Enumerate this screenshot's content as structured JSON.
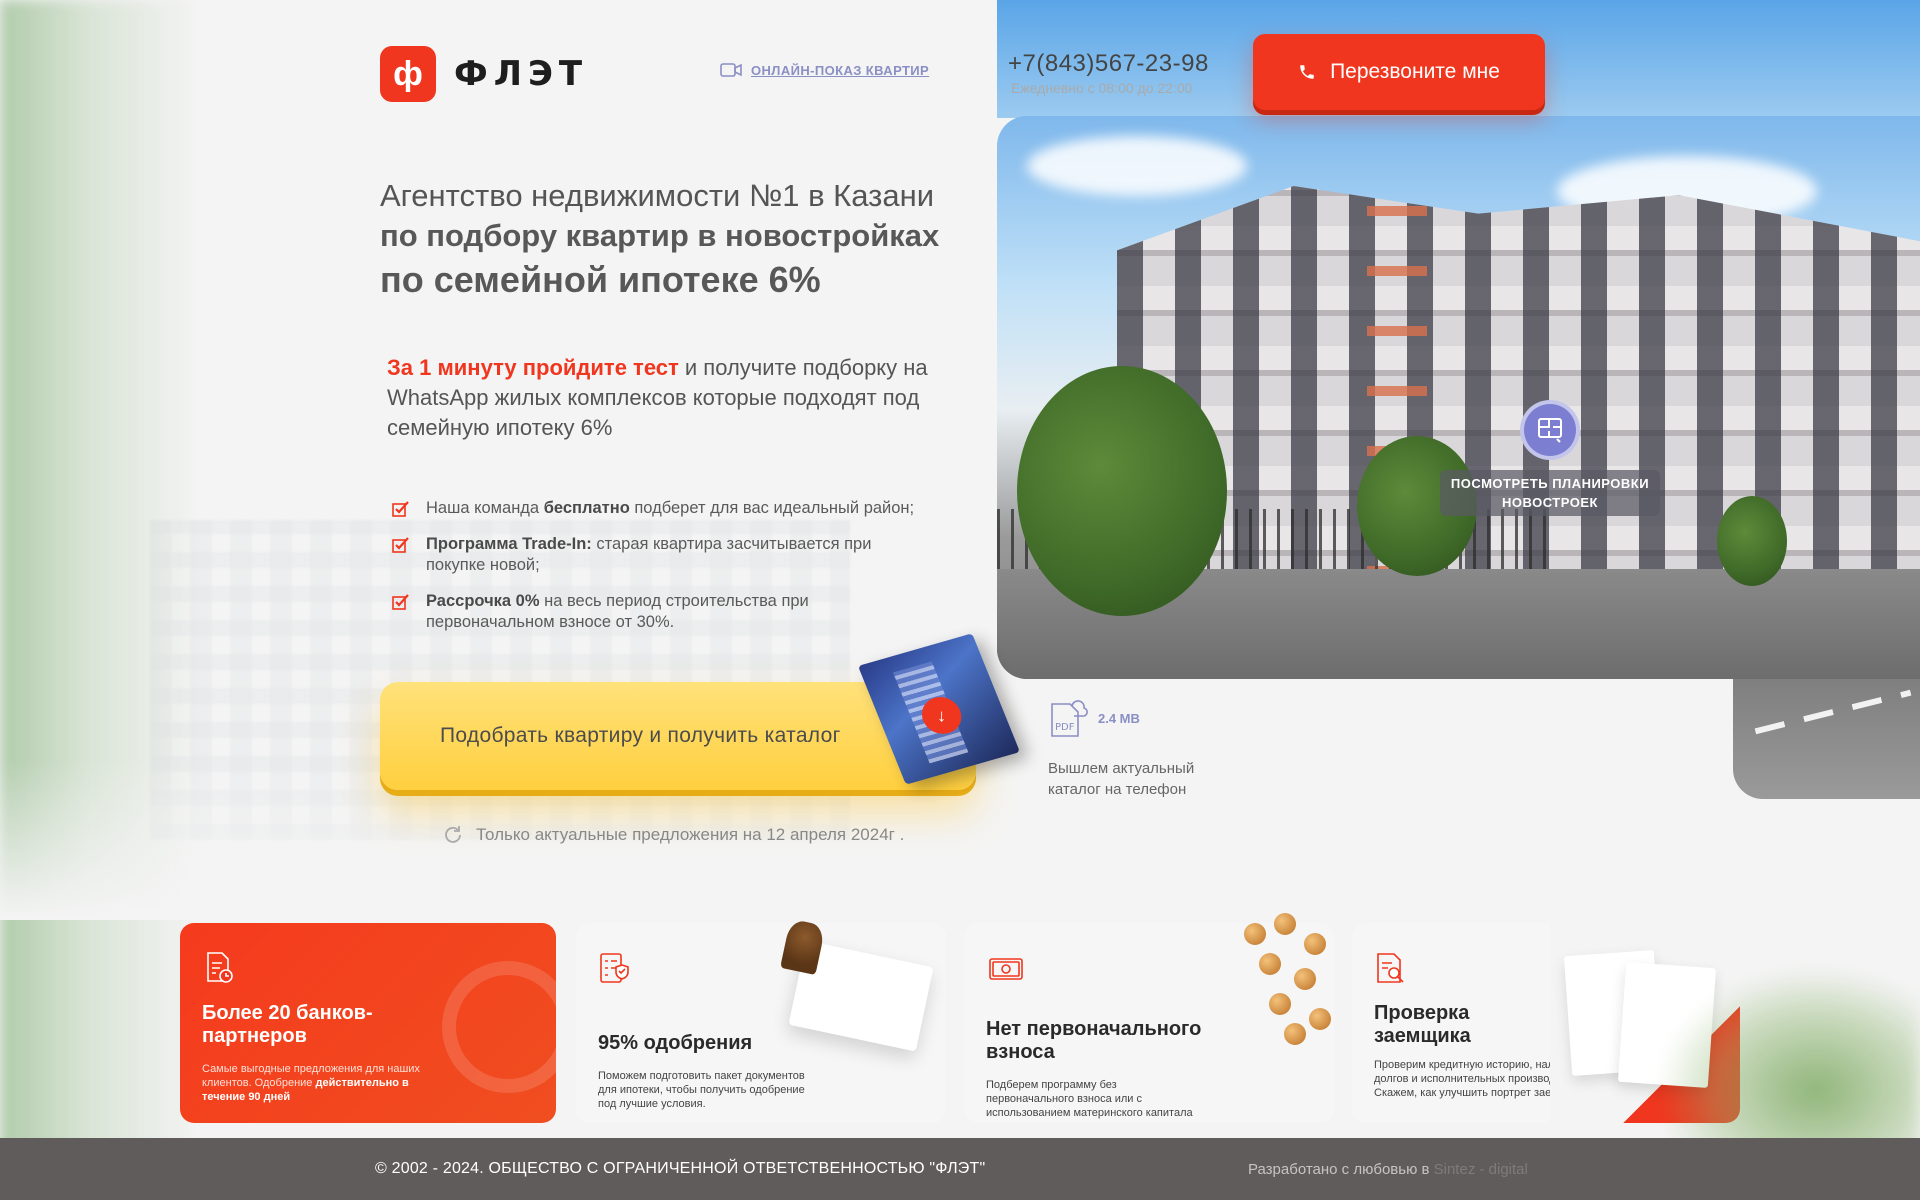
{
  "header": {
    "logo_mark": "ф",
    "logo_text": "ФЛЭТ",
    "online_link": "ОНЛАЙН-ПОКАЗ КВАРТИР",
    "phone": "+7(843)567-23-98",
    "hours": "Ежедневно с 08:00 до 22:00",
    "callback_button": "Перезвоните мне"
  },
  "hero": {
    "headline_1": "Агентство недвижимости №1 в Казани",
    "headline_2": "по подбору квартир в новостройках",
    "headline_3": "по семейной ипотеке 6%",
    "lead_accent": "За 1 минуту пройдите тест",
    "lead_rest": " и получите подборку на WhatsApp жилых комплексов которые подходят под семейную ипотеку 6%",
    "benefits": [
      {
        "prefix": "Наша команда ",
        "bold": "бесплатно",
        "suffix": " подберет для вас идеальный район;"
      },
      {
        "prefix": "",
        "bold": "Программа Trade-In:",
        "suffix": " старая квартира засчитывается при покупке новой;"
      },
      {
        "prefix": "",
        "bold": "Рассрочка 0%",
        "suffix": " на весь период строительства при первоначальном взносе от 30%."
      }
    ],
    "cta_button": "Подобрать квартиру и получить каталог",
    "pdf_size": "2.4 MB",
    "pdf_caption": "Вышлем актуальный каталог на телефон",
    "actual_note": "Только актуальные предложения на 12 апреля 2024г .",
    "plans_label": "ПОСМОТРЕТЬ ПЛАНИРОВКИ НОВОСТРОЕК"
  },
  "features": [
    {
      "title": "Более 20 банков-партнеров",
      "text": "Самые выгодные предложения для наших клиентов. Одобрение ",
      "text_bold": "действительно в течение 90 дней",
      "icon": "document-clock-icon"
    },
    {
      "title": "95% одобрения",
      "text": "Поможем подготовить пакет документов для ипотеки, чтобы получить одобрение под лучшие условия.",
      "icon": "checklist-shield-icon"
    },
    {
      "title": "Нет первоначального взноса",
      "text": "Подберем программу без первоначального взноса или с использованием материнского капитала",
      "icon": "banknote-icon"
    },
    {
      "title": "Проверка заемщика",
      "text": "Проверим кредитную историю, наличие долгов и исполнительных производств. Скажем, как улучшить портрет заемщика.",
      "icon": "document-search-icon"
    }
  ],
  "footer": {
    "copyright": "© 2002 - 2024. ОБЩЕСТВО С ОГРАНИЧЕННОЙ ОТВЕТСТВЕННОСТЬЮ \"ФЛЭТ\"",
    "dev_prefix": "Разработано с любовью в ",
    "dev_link": "Sintez - digital"
  },
  "colors": {
    "accent": "#f0361e",
    "cta": "#ffcf3e",
    "link": "#8a8fc4",
    "footer": "#605c5c"
  }
}
